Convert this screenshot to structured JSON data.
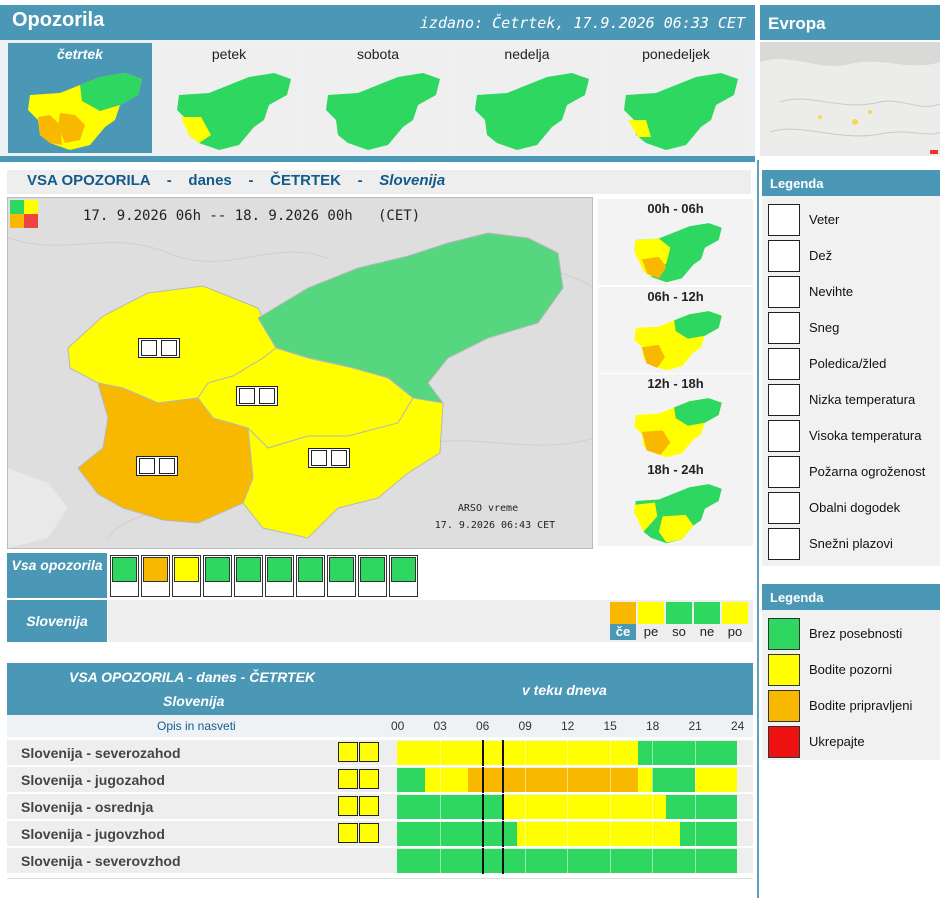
{
  "header": {
    "title": "Opozorila",
    "issued": "izdano: Četrtek, 17.9.2026 06:33 CET"
  },
  "europe": {
    "title": "Evropa"
  },
  "days": [
    {
      "label": "četrtek",
      "selected": true
    },
    {
      "label": "petek",
      "selected": false
    },
    {
      "label": "sobota",
      "selected": false
    },
    {
      "label": "nedelja",
      "selected": false
    },
    {
      "label": "ponedeljek",
      "selected": false
    }
  ],
  "section": {
    "part1": "VSA OPOZORILA",
    "sep": "-",
    "part2": "danes",
    "part3": "ČETRTEK",
    "part4": "Slovenija"
  },
  "map": {
    "range": "17. 9.2026 06h -- 18. 9.2026 00h   (CET)",
    "credit": "ARSO vreme",
    "timestamp": "17. 9.2026  06:43 CET"
  },
  "periods": [
    "00h - 06h",
    "06h - 12h",
    "12h - 18h",
    "18h - 24h"
  ],
  "strip": {
    "all_label": "Vsa opozorila",
    "slovenia_label": "Slovenija"
  },
  "weekdays": [
    {
      "label": "če",
      "color": "#f8b800",
      "selected": true
    },
    {
      "label": "pe",
      "color": "#ffff00",
      "selected": false
    },
    {
      "label": "so",
      "color": "#2ed760",
      "selected": false
    },
    {
      "label": "ne",
      "color": "#2ed760",
      "selected": false
    },
    {
      "label": "po",
      "color": "#ffff00",
      "selected": false
    }
  ],
  "table": {
    "title": "VSA OPOZORILA - danes - ČETRTEK",
    "subtitle": "Slovenija",
    "period_label": "v teku dneva",
    "desc_label": "Opis in nasveti",
    "hours": [
      "00",
      "03",
      "06",
      "09",
      "12",
      "15",
      "18",
      "21",
      "24"
    ],
    "rows": [
      {
        "name": "Slovenija - severozahod",
        "icons": true,
        "segments": [
          [
            "y",
            0,
            17
          ],
          [
            "g",
            17,
            24
          ]
        ]
      },
      {
        "name": "Slovenija - jugozahod",
        "icons": true,
        "segments": [
          [
            "g",
            0,
            2
          ],
          [
            "y",
            2,
            5
          ],
          [
            "o",
            5,
            17
          ],
          [
            "y",
            17,
            18
          ],
          [
            "g",
            18,
            21
          ],
          [
            "y",
            21,
            24
          ]
        ]
      },
      {
        "name": "Slovenija - osrednja",
        "icons": true,
        "segments": [
          [
            "g",
            0,
            7.5
          ],
          [
            "y",
            7.5,
            19
          ],
          [
            "g",
            19,
            24
          ]
        ]
      },
      {
        "name": "Slovenija - jugovzhod",
        "icons": true,
        "segments": [
          [
            "g",
            0,
            8.5
          ],
          [
            "y",
            8.5,
            20
          ],
          [
            "g",
            20,
            24
          ]
        ]
      },
      {
        "name": "Slovenija - severovzhod",
        "icons": false,
        "segments": [
          [
            "g",
            0,
            24
          ]
        ]
      }
    ]
  },
  "legend1": {
    "title": "Legenda",
    "items": [
      {
        "icon": "wind-icon",
        "label": "Veter"
      },
      {
        "icon": "rain-icon",
        "label": "Dež"
      },
      {
        "icon": "thunderstorm-icon",
        "label": "Nevihte"
      },
      {
        "icon": "snow-icon",
        "label": "Sneg"
      },
      {
        "icon": "ice-icon",
        "label": "Poledica/žled"
      },
      {
        "icon": "low-temperature-icon",
        "label": "Nizka temperatura"
      },
      {
        "icon": "high-temperature-icon",
        "label": "Visoka temperatura"
      },
      {
        "icon": "fire-danger-icon",
        "label": "Požarna ogroženost"
      },
      {
        "icon": "coastal-event-icon",
        "label": "Obalni dogodek"
      },
      {
        "icon": "avalanche-icon",
        "label": "Snežni plazovi"
      }
    ]
  },
  "legend2": {
    "title": "Legenda",
    "items": [
      {
        "label": "Brez posebnosti",
        "color": "#2ed760"
      },
      {
        "label": "Bodite pozorni",
        "color": "#ffff00"
      },
      {
        "label": "Bodite pripravljeni",
        "color": "#f8b800"
      },
      {
        "label": "Ukrepajte",
        "color": "#ee1111"
      }
    ]
  },
  "colors": {
    "accent": "#4a97b6",
    "green": "#2ed760",
    "yellow": "#ffff00",
    "orange": "#f8b800",
    "red": "#ee1111"
  }
}
